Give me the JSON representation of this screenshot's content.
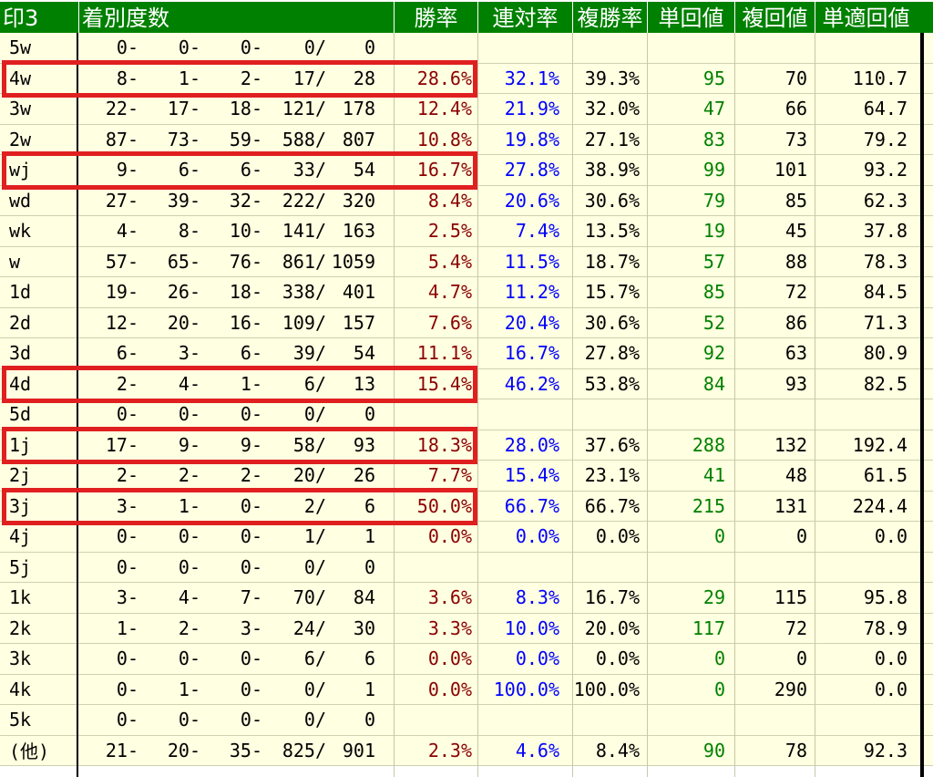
{
  "header": [
    "印3",
    "着別度数",
    "勝率",
    "連対率",
    "複勝率",
    "単回値",
    "複回値",
    "単適回値"
  ],
  "colors": {
    "header_bg": "#008000",
    "cell_bg": "#ffffe1",
    "win_rate": "#8b0000",
    "place_rate": "#0000ff",
    "show_rate": "#000000",
    "tan_value": "#008000",
    "default_text": "#000000",
    "highlight": "#e02020"
  },
  "rows": [
    {
      "mark": "5w",
      "w1": "0-",
      "w2": "0-",
      "w3": "0-",
      "w4": "0/",
      "total": "0",
      "win": "",
      "rentai": "",
      "fukusho": "",
      "tan": "",
      "fuku": "",
      "tekiou": ""
    },
    {
      "mark": "4w",
      "w1": "8-",
      "w2": "1-",
      "w3": "2-",
      "w4": "17/",
      "total": "28",
      "win": "28.6%",
      "rentai": "32.1%",
      "fukusho": "39.3%",
      "tan": "95",
      "fuku": "70",
      "tekiou": "110.7"
    },
    {
      "mark": "3w",
      "w1": "22-",
      "w2": "17-",
      "w3": "18-",
      "w4": "121/",
      "total": "178",
      "win": "12.4%",
      "rentai": "21.9%",
      "fukusho": "32.0%",
      "tan": "47",
      "fuku": "66",
      "tekiou": "64.7"
    },
    {
      "mark": "2w",
      "w1": "87-",
      "w2": "73-",
      "w3": "59-",
      "w4": "588/",
      "total": "807",
      "win": "10.8%",
      "rentai": "19.8%",
      "fukusho": "27.1%",
      "tan": "83",
      "fuku": "73",
      "tekiou": "79.2"
    },
    {
      "mark": "wj",
      "w1": "9-",
      "w2": "6-",
      "w3": "6-",
      "w4": "33/",
      "total": "54",
      "win": "16.7%",
      "rentai": "27.8%",
      "fukusho": "38.9%",
      "tan": "99",
      "fuku": "101",
      "tekiou": "93.2"
    },
    {
      "mark": "wd",
      "w1": "27-",
      "w2": "39-",
      "w3": "32-",
      "w4": "222/",
      "total": "320",
      "win": "8.4%",
      "rentai": "20.6%",
      "fukusho": "30.6%",
      "tan": "79",
      "fuku": "85",
      "tekiou": "62.3"
    },
    {
      "mark": "wk",
      "w1": "4-",
      "w2": "8-",
      "w3": "10-",
      "w4": "141/",
      "total": "163",
      "win": "2.5%",
      "rentai": "7.4%",
      "fukusho": "13.5%",
      "tan": "19",
      "fuku": "45",
      "tekiou": "37.8"
    },
    {
      "mark": "w",
      "w1": "57-",
      "w2": "65-",
      "w3": "76-",
      "w4": "861/",
      "total": "1059",
      "win": "5.4%",
      "rentai": "11.5%",
      "fukusho": "18.7%",
      "tan": "57",
      "fuku": "88",
      "tekiou": "78.3"
    },
    {
      "mark": "1d",
      "w1": "19-",
      "w2": "26-",
      "w3": "18-",
      "w4": "338/",
      "total": "401",
      "win": "4.7%",
      "rentai": "11.2%",
      "fukusho": "15.7%",
      "tan": "85",
      "fuku": "72",
      "tekiou": "84.5"
    },
    {
      "mark": "2d",
      "w1": "12-",
      "w2": "20-",
      "w3": "16-",
      "w4": "109/",
      "total": "157",
      "win": "7.6%",
      "rentai": "20.4%",
      "fukusho": "30.6%",
      "tan": "52",
      "fuku": "86",
      "tekiou": "71.3"
    },
    {
      "mark": "3d",
      "w1": "6-",
      "w2": "3-",
      "w3": "6-",
      "w4": "39/",
      "total": "54",
      "win": "11.1%",
      "rentai": "16.7%",
      "fukusho": "27.8%",
      "tan": "92",
      "fuku": "63",
      "tekiou": "80.9"
    },
    {
      "mark": "4d",
      "w1": "2-",
      "w2": "4-",
      "w3": "1-",
      "w4": "6/",
      "total": "13",
      "win": "15.4%",
      "rentai": "46.2%",
      "fukusho": "53.8%",
      "tan": "84",
      "fuku": "93",
      "tekiou": "82.5"
    },
    {
      "mark": "5d",
      "w1": "0-",
      "w2": "0-",
      "w3": "0-",
      "w4": "0/",
      "total": "0",
      "win": "",
      "rentai": "",
      "fukusho": "",
      "tan": "",
      "fuku": "",
      "tekiou": ""
    },
    {
      "mark": "1j",
      "w1": "17-",
      "w2": "9-",
      "w3": "9-",
      "w4": "58/",
      "total": "93",
      "win": "18.3%",
      "rentai": "28.0%",
      "fukusho": "37.6%",
      "tan": "288",
      "fuku": "132",
      "tekiou": "192.4"
    },
    {
      "mark": "2j",
      "w1": "2-",
      "w2": "2-",
      "w3": "2-",
      "w4": "20/",
      "total": "26",
      "win": "7.7%",
      "rentai": "15.4%",
      "fukusho": "23.1%",
      "tan": "41",
      "fuku": "48",
      "tekiou": "61.5"
    },
    {
      "mark": "3j",
      "w1": "3-",
      "w2": "1-",
      "w3": "0-",
      "w4": "2/",
      "total": "6",
      "win": "50.0%",
      "rentai": "66.7%",
      "fukusho": "66.7%",
      "tan": "215",
      "fuku": "131",
      "tekiou": "224.4"
    },
    {
      "mark": "4j",
      "w1": "0-",
      "w2": "0-",
      "w3": "0-",
      "w4": "1/",
      "total": "1",
      "win": "0.0%",
      "rentai": "0.0%",
      "fukusho": "0.0%",
      "tan": "0",
      "fuku": "0",
      "tekiou": "0.0"
    },
    {
      "mark": "5j",
      "w1": "0-",
      "w2": "0-",
      "w3": "0-",
      "w4": "0/",
      "total": "0",
      "win": "",
      "rentai": "",
      "fukusho": "",
      "tan": "",
      "fuku": "",
      "tekiou": ""
    },
    {
      "mark": "1k",
      "w1": "3-",
      "w2": "4-",
      "w3": "7-",
      "w4": "70/",
      "total": "84",
      "win": "3.6%",
      "rentai": "8.3%",
      "fukusho": "16.7%",
      "tan": "29",
      "fuku": "115",
      "tekiou": "95.8"
    },
    {
      "mark": "2k",
      "w1": "1-",
      "w2": "2-",
      "w3": "3-",
      "w4": "24/",
      "total": "30",
      "win": "3.3%",
      "rentai": "10.0%",
      "fukusho": "20.0%",
      "tan": "117",
      "fuku": "72",
      "tekiou": "78.9"
    },
    {
      "mark": "3k",
      "w1": "0-",
      "w2": "0-",
      "w3": "0-",
      "w4": "6/",
      "total": "6",
      "win": "0.0%",
      "rentai": "0.0%",
      "fukusho": "0.0%",
      "tan": "0",
      "fuku": "0",
      "tekiou": "0.0"
    },
    {
      "mark": "4k",
      "w1": "0-",
      "w2": "1-",
      "w3": "0-",
      "w4": "0/",
      "total": "1",
      "win": "0.0%",
      "rentai": "100.0%",
      "fukusho": "100.0%",
      "tan": "0",
      "fuku": "290",
      "tekiou": "0.0"
    },
    {
      "mark": "5k",
      "w1": "0-",
      "w2": "0-",
      "w3": "0-",
      "w4": "0/",
      "total": "0",
      "win": "",
      "rentai": "",
      "fukusho": "",
      "tan": "",
      "fuku": "",
      "tekiou": ""
    },
    {
      "mark": "(他)",
      "w1": "21-",
      "w2": "20-",
      "w3": "35-",
      "w4": "825/",
      "total": "901",
      "win": "2.3%",
      "rentai": "4.6%",
      "fukusho": "8.4%",
      "tan": "90",
      "fuku": "78",
      "tekiou": "92.3"
    }
  ],
  "highlighted_marks": [
    "4w",
    "wj",
    "4d",
    "1j",
    "3j"
  ]
}
